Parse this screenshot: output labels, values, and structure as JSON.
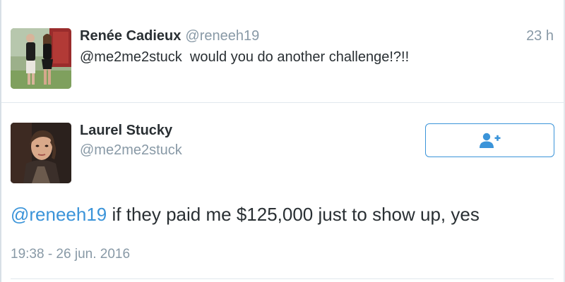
{
  "reply": {
    "display_name": "Renée Cadieux",
    "handle": "@reneeh19",
    "timestamp": "23 h",
    "text": "@me2me2stuck  would you do another challenge!?!!"
  },
  "main": {
    "display_name": "Laurel Stucky",
    "handle": "@me2me2stuck",
    "text_mention": "@reneeh19",
    "text_body": " if they paid me $125,000 just to show up, yes",
    "date": "19:38 - 26 jun. 2016",
    "follow_icon": "add-user-icon"
  },
  "colors": {
    "accent": "#3b94d9",
    "text": "#292f33",
    "muted": "#8899a6",
    "divider": "#e1e8ed"
  }
}
